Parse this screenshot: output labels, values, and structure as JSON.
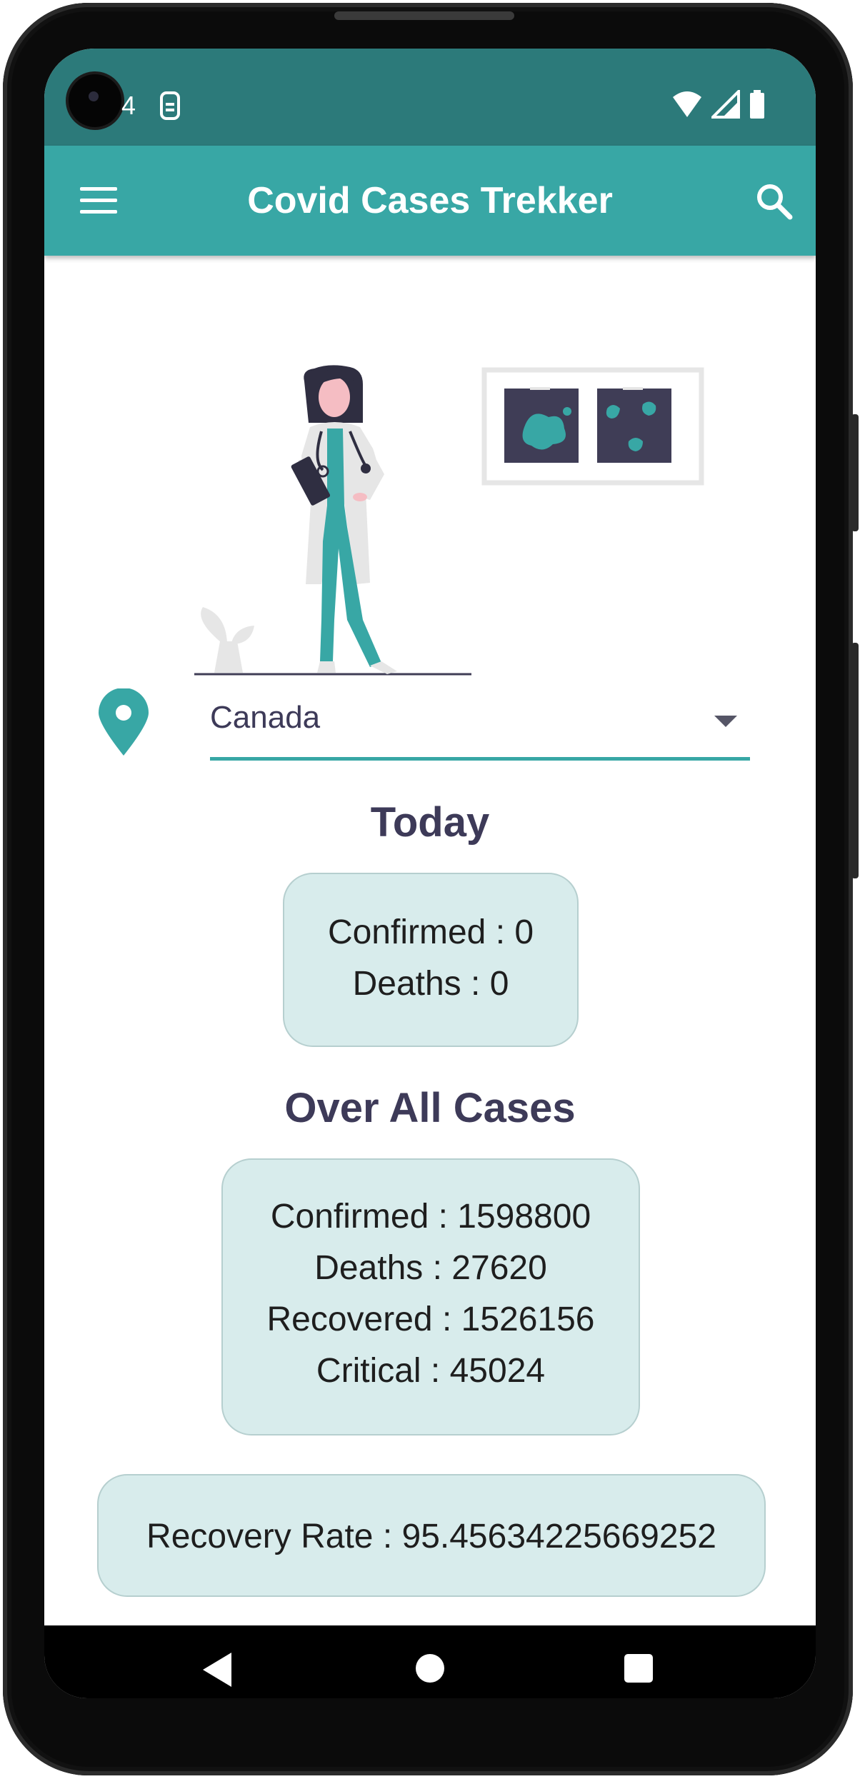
{
  "status_bar": {
    "notification_number": "4",
    "icons": [
      "camera-icon",
      "sim-icon",
      "wifi-icon",
      "signal-icon",
      "battery-icon"
    ]
  },
  "app_bar": {
    "title": "Covid Cases Trekker",
    "icons": [
      "menu-icon",
      "search-icon"
    ]
  },
  "colors": {
    "primary": "#38a7a5",
    "primary_dark": "#2c7a7a",
    "card_background": "#d8ecec",
    "heading_text": "#3d3a58"
  },
  "country_selector": {
    "icon": "location-pin-icon",
    "selected": "Canada"
  },
  "today": {
    "heading": "Today",
    "confirmed": "Confirmed : 0",
    "deaths": "Deaths : 0"
  },
  "overall": {
    "heading": "Over All Cases",
    "confirmed": "Confirmed : 1598800",
    "deaths": "Deaths : 27620",
    "recovered": "Recovered : 1526156",
    "critical": "Critical : 45024"
  },
  "recovery": {
    "text": "Recovery Rate : 95.45634225669252"
  },
  "nav_bar": {
    "icons": [
      "back-icon",
      "home-icon",
      "recents-icon"
    ]
  }
}
